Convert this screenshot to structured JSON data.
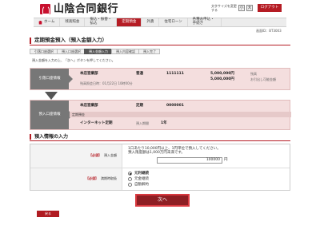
{
  "header": {
    "bank_name": "山陰合同銀行",
    "font_size_label": "文字サイズを変更する",
    "font_small": "小",
    "font_large": "大",
    "logout": "ログアウト"
  },
  "nav": {
    "items": [
      {
        "label": "ホーム"
      },
      {
        "label": "残高照会"
      },
      {
        "label": "振込・振替・払込"
      },
      {
        "label": "定期預金"
      },
      {
        "label": "外貨"
      },
      {
        "label": "住宅ローン"
      },
      {
        "label": "各種お申込・手続き"
      }
    ]
  },
  "screen_id": "画面ID：BT3003",
  "page": {
    "title": "定期預金預入（預入金額入力）",
    "steps": [
      "引落口座選択",
      "預入口座選択",
      "預入金額入力",
      "預入内容確認",
      "預入完了"
    ],
    "active_step": 2,
    "instruction": "預入金額を入力の上、「次へ」ボタンを押してください。"
  },
  "from_account": {
    "label": "引落口座情報",
    "branch": "本店営業部",
    "type": "普通",
    "number": "1111111",
    "balance": "5,000,000円",
    "balance_note": "残高",
    "available": "5,000,000円",
    "available_note": "お引出し可能金額",
    "date_note": "残高照会日時：01月22日 10時00分"
  },
  "to_account": {
    "label": "預入口座情報",
    "branch": "本店営業部",
    "type": "定期",
    "number": "0000001",
    "product_header": "定期預金",
    "product_name": "インターネット定期",
    "period_label": "預入期間",
    "period_value": "1年"
  },
  "input_section": {
    "title": "預入情報の入力",
    "amount_label": "預入金額",
    "required_mark": "必須",
    "amount_note_1": "1口あたり10,000円以上、1円単位で預入してください。",
    "amount_note_2": "預入限度額は1,000万円未満です。",
    "amount_value": "100000",
    "amount_unit": "円",
    "renewal_label": "満期時取扱",
    "renewal_options": [
      "元利継続",
      "元金継続",
      "自動解約"
    ],
    "renewal_selected": 0
  },
  "actions": {
    "next": "次へ",
    "back": "戻る"
  }
}
